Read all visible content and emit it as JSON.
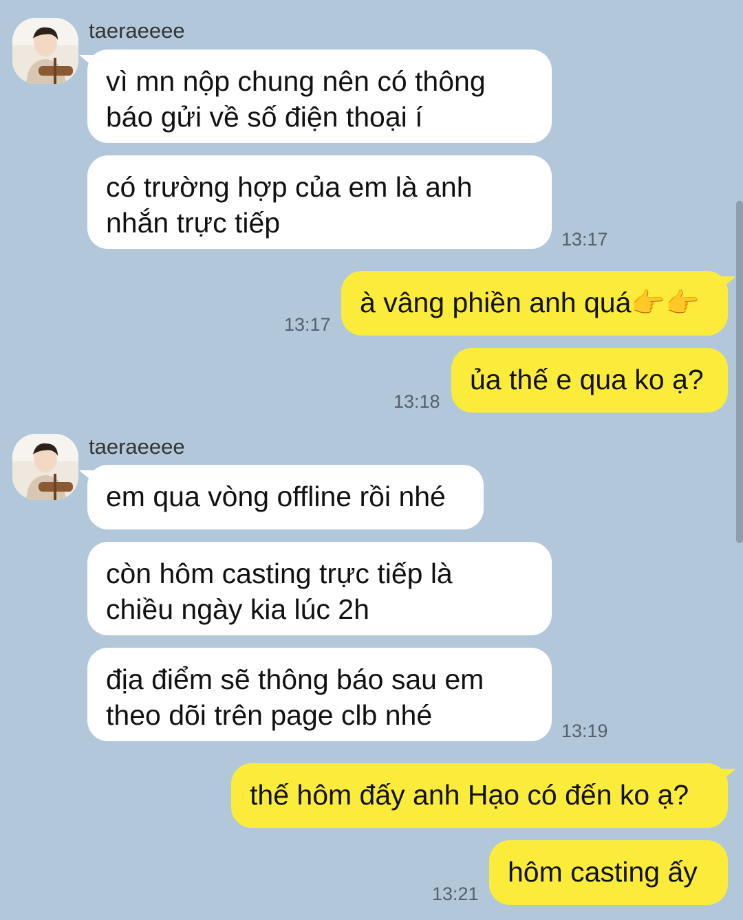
{
  "sender_name": "taeraeeee",
  "messages": [
    {
      "id": "m1",
      "side": "in",
      "lines": [
        "vì mn nộp chung nên có thông",
        "báo gửi về số điện thoại í"
      ]
    },
    {
      "id": "m2",
      "side": "in",
      "lines": [
        "có trường hợp của em là anh",
        "nhắn trực tiếp"
      ],
      "time": "13:17"
    },
    {
      "id": "m3",
      "side": "out",
      "text": "à vâng phiền anh quá",
      "emoji": "👉👉",
      "time": "13:17"
    },
    {
      "id": "m4",
      "side": "out",
      "text": "ủa thế e qua ko ạ?",
      "time": "13:18"
    },
    {
      "id": "m5",
      "side": "in",
      "lines": [
        "em qua vòng offline rồi nhé"
      ]
    },
    {
      "id": "m6",
      "side": "in",
      "lines": [
        "còn hôm casting trực tiếp là",
        "chiều ngày kia lúc 2h"
      ]
    },
    {
      "id": "m7",
      "side": "in",
      "lines": [
        "địa điểm sẽ thông báo sau em",
        "theo dõi trên page clb nhé"
      ],
      "time": "13:19"
    },
    {
      "id": "m8",
      "side": "out",
      "text": "thế hôm đấy anh Hạo có đến ko ạ?"
    },
    {
      "id": "m9",
      "side": "out",
      "text": "hôm casting ấy",
      "time": "13:21"
    }
  ],
  "colors": {
    "background": "#b2c7da",
    "incoming": "#ffffff",
    "outgoing": "#fbec3c"
  }
}
